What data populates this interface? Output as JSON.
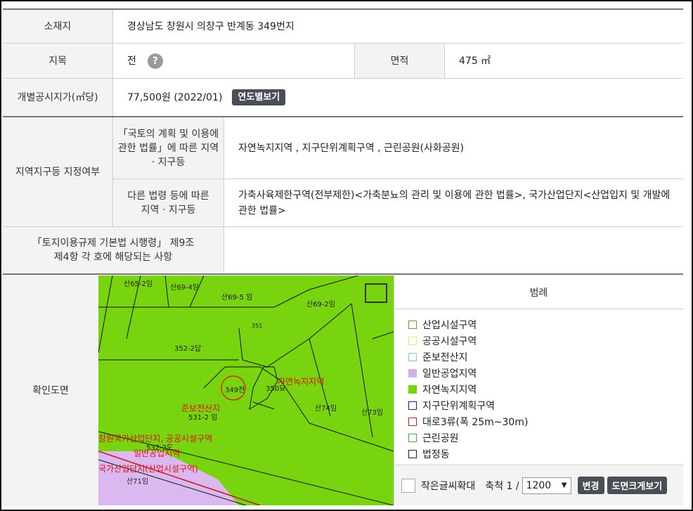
{
  "rows": {
    "location": {
      "label": "소재지",
      "value": "경상남도 창원시 의창구 반계동 349번지"
    },
    "land_category": {
      "label": "지목",
      "value": "전",
      "help_icon": "question-icon"
    },
    "area": {
      "label": "면적",
      "value": "475 ㎡"
    },
    "official_price": {
      "label": "개별공시지가(㎡당)",
      "value": "77,500원 (2022/01)",
      "button": "연도별보기"
    },
    "zoning": {
      "label": "지역지구등 지정여부",
      "sub1_label": "「국토의 계획 및 이용에 관한 법률」에 따른 지역 · 지구등",
      "sub1_value": "자연녹지지역 , 지구단위계획구역 , 근린공원(사화공원)",
      "sub2_label": "다른 법령 등에 따른 지역 · 지구등",
      "sub2_value": "가축사육제한구역(전부제한)<가축분뇨의 관리 및 이용에 관한 법률>, 국가산업단지<산업입지 및 개발에 관한 법률>"
    },
    "regulation": {
      "label": "「토지이용규제 기본법 시행령」 제9조 제4항 각 호에 해당되는 사항",
      "value": ""
    },
    "map": {
      "label": "확인도면"
    }
  },
  "map_labels": {
    "p1": "산65-2임",
    "p2": "산69-4임",
    "p3": "산69-5 임",
    "p4": "산69-2임",
    "p5": "351",
    "p6": "352-2답",
    "p7": "349전",
    "p8": "350묘",
    "p9": "산74임",
    "p10": "산73임",
    "p11": "531-2 임",
    "p12": "532-2도",
    "p13": "산71임",
    "r1": "자연녹지지역",
    "r2": "준보전산지",
    "r3": "창원국가산업단지, 공공시설구역",
    "r4": "일반공업지역",
    "r5": "국가산업단지(산업시설구역)"
  },
  "legend": {
    "title": "범례",
    "items": [
      {
        "label": "산업시설구역",
        "color": "#8a8a2a",
        "fill": "none"
      },
      {
        "label": "공공시설구역",
        "color": "#e6e680",
        "fill": "none"
      },
      {
        "label": "준보전산지",
        "color": "#7ad0c8",
        "fill": "none"
      },
      {
        "label": "일반공업지역",
        "color": "#d8b0e8",
        "fill": "#d8b0e8"
      },
      {
        "label": "자연녹지지역",
        "color": "#79d410",
        "fill": "#79d410"
      },
      {
        "label": "지구단위계획구역",
        "color": "#1a1a9a",
        "fill": "none"
      },
      {
        "label": "대로3류(폭 25m~30m)",
        "color": "#c02020",
        "fill": "none"
      },
      {
        "label": "근린공원",
        "color": "#40b040",
        "fill": "none"
      },
      {
        "label": "법정동",
        "color": "#222222",
        "fill": "none"
      }
    ],
    "small_text_label": "작은글씨확대",
    "scale_label": "축척 1 /",
    "scale_value": "1200",
    "change_button": "변경",
    "enlarge_button": "도면크게보기"
  }
}
